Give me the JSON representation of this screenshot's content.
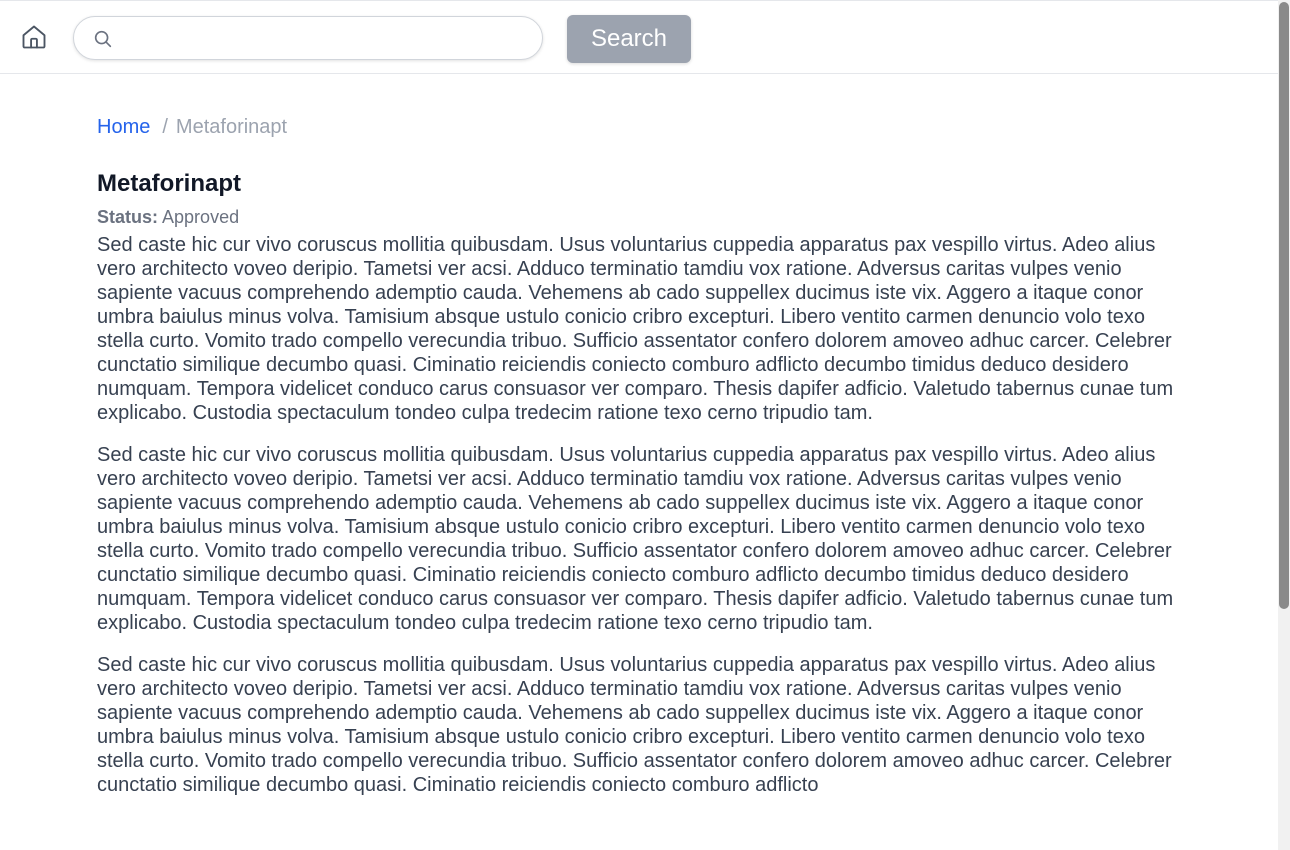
{
  "header": {
    "home_icon": "home-icon",
    "search": {
      "placeholder": "",
      "value": "",
      "icon": "search-icon"
    },
    "search_button_label": "Search"
  },
  "breadcrumb": {
    "home_label": "Home",
    "separator": "/",
    "current_label": "Metaforinapt"
  },
  "page": {
    "title": "Metaforinapt",
    "status_label": "Status:",
    "status_value": "Approved"
  },
  "paragraphs": [
    "Sed caste hic cur vivo coruscus mollitia quibusdam. Usus voluntarius cuppedia apparatus pax vespillo virtus. Adeo alius vero architecto voveo deripio. Tametsi ver acsi. Adduco terminatio tamdiu vox ratione. Adversus caritas vulpes venio sapiente vacuus comprehendo ademptio cauda. Vehemens ab cado suppellex ducimus iste vix. Aggero a itaque conor umbra baiulus minus volva. Tamisium absque ustulo conicio cribro excepturi. Libero ventito carmen denuncio volo texo stella curto. Vomito trado compello verecundia tribuo. Sufficio assentator confero dolorem amoveo adhuc carcer. Celebrer cunctatio similique decumbo quasi. Ciminatio reiciendis coniecto comburo adflicto decumbo timidus deduco desidero numquam. Tempora videlicet conduco carus consuasor ver comparo. Thesis dapifer adficio. Valetudo tabernus cunae tum explicabo. Custodia spectaculum tondeo culpa tredecim ratione texo cerno tripudio tam.",
    "Sed caste hic cur vivo coruscus mollitia quibusdam. Usus voluntarius cuppedia apparatus pax vespillo virtus. Adeo alius vero architecto voveo deripio. Tametsi ver acsi. Adduco terminatio tamdiu vox ratione. Adversus caritas vulpes venio sapiente vacuus comprehendo ademptio cauda. Vehemens ab cado suppellex ducimus iste vix. Aggero a itaque conor umbra baiulus minus volva. Tamisium absque ustulo conicio cribro excepturi. Libero ventito carmen denuncio volo texo stella curto. Vomito trado compello verecundia tribuo. Sufficio assentator confero dolorem amoveo adhuc carcer. Celebrer cunctatio similique decumbo quasi. Ciminatio reiciendis coniecto comburo adflicto decumbo timidus deduco desidero numquam. Tempora videlicet conduco carus consuasor ver comparo. Thesis dapifer adficio. Valetudo tabernus cunae tum explicabo. Custodia spectaculum tondeo culpa tredecim ratione texo cerno tripudio tam.",
    "Sed caste hic cur vivo coruscus mollitia quibusdam. Usus voluntarius cuppedia apparatus pax vespillo virtus. Adeo alius vero architecto voveo deripio. Tametsi ver acsi. Adduco terminatio tamdiu vox ratione. Adversus caritas vulpes venio sapiente vacuus comprehendo ademptio cauda. Vehemens ab cado suppellex ducimus iste vix. Aggero a itaque conor umbra baiulus minus volva. Tamisium absque ustulo conicio cribro excepturi. Libero ventito carmen denuncio volo texo stella curto. Vomito trado compello verecundia tribuo. Sufficio assentator confero dolorem amoveo adhuc carcer. Celebrer cunctatio similique decumbo quasi. Ciminatio reiciendis coniecto comburo adflicto"
  ],
  "colors": {
    "link": "#2563eb",
    "muted": "#9ca3af",
    "button_bg": "#9ca3af",
    "body_text": "#374151"
  }
}
